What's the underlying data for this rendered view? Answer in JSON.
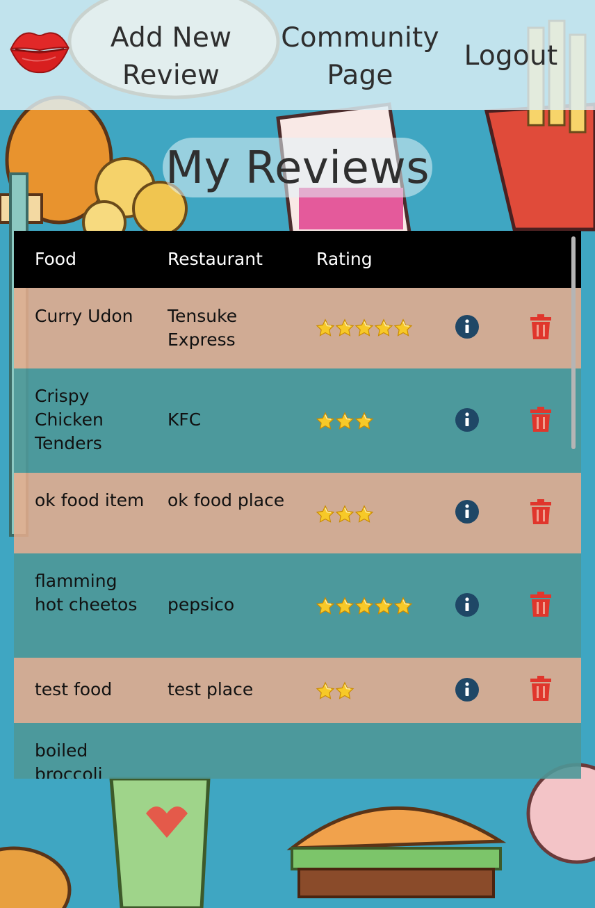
{
  "nav": {
    "logo_icon": "lips-icon",
    "add_review": "Add New Review",
    "community": "Community Page",
    "logout": "Logout"
  },
  "page": {
    "title": "My Reviews"
  },
  "table": {
    "headers": {
      "food": "Food",
      "restaurant": "Restaurant",
      "rating": "Rating"
    },
    "rows": [
      {
        "food": "Curry Udon",
        "restaurant": "Tensuke Express",
        "rating": 5
      },
      {
        "food": "Crispy Chicken Tenders",
        "restaurant": "KFC",
        "rating": 3
      },
      {
        "food": "ok food item",
        "restaurant": "ok food place",
        "rating": 3
      },
      {
        "food": "flamming hot cheetos",
        "restaurant": "pepsico",
        "rating": 5
      },
      {
        "food": "test food",
        "restaurant": "test place",
        "rating": 2
      },
      {
        "food": "boiled broccoli",
        "restaurant": "",
        "rating": null
      }
    ],
    "row_icons": {
      "info": "info-circle-icon",
      "delete": "trash-icon"
    }
  },
  "colors": {
    "nav_bg": "#def0f7",
    "header_bg": "#000000",
    "row_peach": "#e8ac8c",
    "row_teal": "#4e9898",
    "info_icon": "#1f4766",
    "trash_icon": "#e0362c",
    "star": "#f7c928",
    "background": "#3fa6c2"
  }
}
